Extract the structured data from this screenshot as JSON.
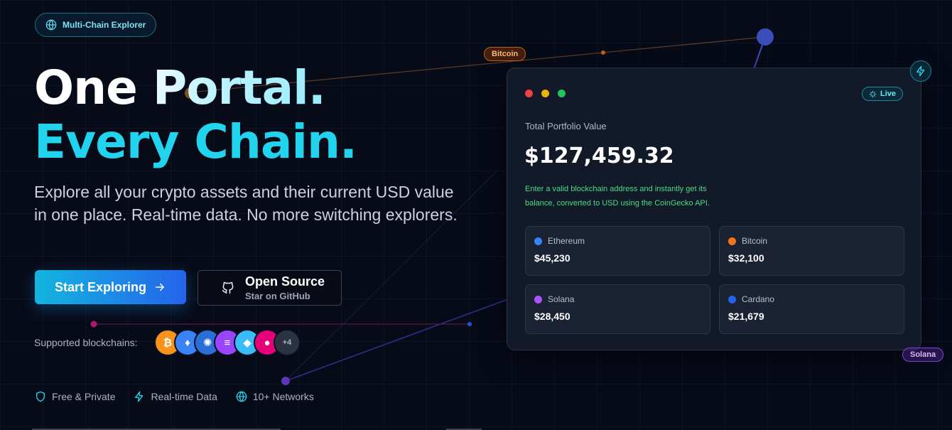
{
  "badge": {
    "label": "Multi-Chain Explorer",
    "icon": "globe-icon"
  },
  "hero": {
    "line1": "One Portal.",
    "line2": "Every Chain.",
    "subtitle": "Explore all your crypto assets and their current USD value in one place. Real-time data. No more switching explorers."
  },
  "cta": {
    "primary_label": "Start Exploring",
    "primary_icon": "arrow-right-icon",
    "secondary_title": "Open Source",
    "secondary_subtitle": "Star on GitHub",
    "secondary_icon": "github-icon"
  },
  "supported": {
    "label": "Supported blockchains:",
    "coins": [
      {
        "name": "Bitcoin",
        "glyph": "₿",
        "color": "#f7931a"
      },
      {
        "name": "Ethereum",
        "glyph": "♦",
        "color": "#3b82f6"
      },
      {
        "name": "Cardano",
        "glyph": "✺",
        "color": "#2a6fd6"
      },
      {
        "name": "Solana",
        "glyph": "≡",
        "color": "#9945ff"
      },
      {
        "name": "Sui",
        "glyph": "◆",
        "color": "#38bdf8"
      },
      {
        "name": "Polkadot",
        "glyph": "●",
        "color": "#e6007a"
      }
    ],
    "more_label": "+4"
  },
  "features": [
    {
      "label": "Free & Private",
      "icon": "shield-icon"
    },
    {
      "label": "Real-time Data",
      "icon": "bolt-icon"
    },
    {
      "label": "10+ Networks",
      "icon": "globe-icon"
    }
  ],
  "floating_tags": {
    "bitcoin": "Bitcoin",
    "solana": "Solana"
  },
  "card": {
    "live_label": "Live",
    "portfolio_label": "Total Portfolio Value",
    "portfolio_value": "$127,459.32",
    "note": "Enter a valid blockchain address and instantly get its balance, converted to USD using the CoinGecko API.",
    "assets": [
      {
        "name": "Ethereum",
        "value": "$45,230",
        "color": "#3b82f6"
      },
      {
        "name": "Bitcoin",
        "value": "$32,100",
        "color": "#f97316"
      },
      {
        "name": "Solana",
        "value": "$28,450",
        "color": "#a855f7"
      },
      {
        "name": "Cardano",
        "value": "$21,679",
        "color": "#2563eb"
      }
    ]
  },
  "colors": {
    "accent": "#22d3ee",
    "background": "#070b18",
    "note_green": "#4ade80"
  }
}
